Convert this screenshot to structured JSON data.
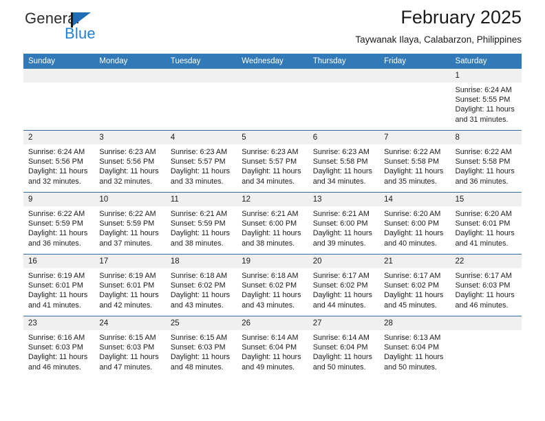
{
  "brand": {
    "name_part1": "General",
    "name_part2": "Blue",
    "flag_icon": "triangle-flag-icon",
    "accent_color": "#1f7fd0"
  },
  "header": {
    "title": "February 2025",
    "subtitle": "Taywanak Ilaya, Calabarzon, Philippines"
  },
  "theme": {
    "header_row_color": "#3279b8",
    "daynum_band_color": "#f0f0f0",
    "row_divider_color": "#2f6ea5"
  },
  "calendar": {
    "weekday_headers": [
      "Sunday",
      "Monday",
      "Tuesday",
      "Wednesday",
      "Thursday",
      "Friday",
      "Saturday"
    ],
    "weeks": [
      [
        {
          "day": "",
          "sunrise": "",
          "sunset": "",
          "daylight1": "",
          "daylight2": ""
        },
        {
          "day": "",
          "sunrise": "",
          "sunset": "",
          "daylight1": "",
          "daylight2": ""
        },
        {
          "day": "",
          "sunrise": "",
          "sunset": "",
          "daylight1": "",
          "daylight2": ""
        },
        {
          "day": "",
          "sunrise": "",
          "sunset": "",
          "daylight1": "",
          "daylight2": ""
        },
        {
          "day": "",
          "sunrise": "",
          "sunset": "",
          "daylight1": "",
          "daylight2": ""
        },
        {
          "day": "",
          "sunrise": "",
          "sunset": "",
          "daylight1": "",
          "daylight2": ""
        },
        {
          "day": "1",
          "sunrise": "Sunrise: 6:24 AM",
          "sunset": "Sunset: 5:55 PM",
          "daylight1": "Daylight: 11 hours",
          "daylight2": "and 31 minutes."
        }
      ],
      [
        {
          "day": "2",
          "sunrise": "Sunrise: 6:24 AM",
          "sunset": "Sunset: 5:56 PM",
          "daylight1": "Daylight: 11 hours",
          "daylight2": "and 32 minutes."
        },
        {
          "day": "3",
          "sunrise": "Sunrise: 6:23 AM",
          "sunset": "Sunset: 5:56 PM",
          "daylight1": "Daylight: 11 hours",
          "daylight2": "and 32 minutes."
        },
        {
          "day": "4",
          "sunrise": "Sunrise: 6:23 AM",
          "sunset": "Sunset: 5:57 PM",
          "daylight1": "Daylight: 11 hours",
          "daylight2": "and 33 minutes."
        },
        {
          "day": "5",
          "sunrise": "Sunrise: 6:23 AM",
          "sunset": "Sunset: 5:57 PM",
          "daylight1": "Daylight: 11 hours",
          "daylight2": "and 34 minutes."
        },
        {
          "day": "6",
          "sunrise": "Sunrise: 6:23 AM",
          "sunset": "Sunset: 5:58 PM",
          "daylight1": "Daylight: 11 hours",
          "daylight2": "and 34 minutes."
        },
        {
          "day": "7",
          "sunrise": "Sunrise: 6:22 AM",
          "sunset": "Sunset: 5:58 PM",
          "daylight1": "Daylight: 11 hours",
          "daylight2": "and 35 minutes."
        },
        {
          "day": "8",
          "sunrise": "Sunrise: 6:22 AM",
          "sunset": "Sunset: 5:58 PM",
          "daylight1": "Daylight: 11 hours",
          "daylight2": "and 36 minutes."
        }
      ],
      [
        {
          "day": "9",
          "sunrise": "Sunrise: 6:22 AM",
          "sunset": "Sunset: 5:59 PM",
          "daylight1": "Daylight: 11 hours",
          "daylight2": "and 36 minutes."
        },
        {
          "day": "10",
          "sunrise": "Sunrise: 6:22 AM",
          "sunset": "Sunset: 5:59 PM",
          "daylight1": "Daylight: 11 hours",
          "daylight2": "and 37 minutes."
        },
        {
          "day": "11",
          "sunrise": "Sunrise: 6:21 AM",
          "sunset": "Sunset: 5:59 PM",
          "daylight1": "Daylight: 11 hours",
          "daylight2": "and 38 minutes."
        },
        {
          "day": "12",
          "sunrise": "Sunrise: 6:21 AM",
          "sunset": "Sunset: 6:00 PM",
          "daylight1": "Daylight: 11 hours",
          "daylight2": "and 38 minutes."
        },
        {
          "day": "13",
          "sunrise": "Sunrise: 6:21 AM",
          "sunset": "Sunset: 6:00 PM",
          "daylight1": "Daylight: 11 hours",
          "daylight2": "and 39 minutes."
        },
        {
          "day": "14",
          "sunrise": "Sunrise: 6:20 AM",
          "sunset": "Sunset: 6:00 PM",
          "daylight1": "Daylight: 11 hours",
          "daylight2": "and 40 minutes."
        },
        {
          "day": "15",
          "sunrise": "Sunrise: 6:20 AM",
          "sunset": "Sunset: 6:01 PM",
          "daylight1": "Daylight: 11 hours",
          "daylight2": "and 41 minutes."
        }
      ],
      [
        {
          "day": "16",
          "sunrise": "Sunrise: 6:19 AM",
          "sunset": "Sunset: 6:01 PM",
          "daylight1": "Daylight: 11 hours",
          "daylight2": "and 41 minutes."
        },
        {
          "day": "17",
          "sunrise": "Sunrise: 6:19 AM",
          "sunset": "Sunset: 6:01 PM",
          "daylight1": "Daylight: 11 hours",
          "daylight2": "and 42 minutes."
        },
        {
          "day": "18",
          "sunrise": "Sunrise: 6:18 AM",
          "sunset": "Sunset: 6:02 PM",
          "daylight1": "Daylight: 11 hours",
          "daylight2": "and 43 minutes."
        },
        {
          "day": "19",
          "sunrise": "Sunrise: 6:18 AM",
          "sunset": "Sunset: 6:02 PM",
          "daylight1": "Daylight: 11 hours",
          "daylight2": "and 43 minutes."
        },
        {
          "day": "20",
          "sunrise": "Sunrise: 6:17 AM",
          "sunset": "Sunset: 6:02 PM",
          "daylight1": "Daylight: 11 hours",
          "daylight2": "and 44 minutes."
        },
        {
          "day": "21",
          "sunrise": "Sunrise: 6:17 AM",
          "sunset": "Sunset: 6:02 PM",
          "daylight1": "Daylight: 11 hours",
          "daylight2": "and 45 minutes."
        },
        {
          "day": "22",
          "sunrise": "Sunrise: 6:17 AM",
          "sunset": "Sunset: 6:03 PM",
          "daylight1": "Daylight: 11 hours",
          "daylight2": "and 46 minutes."
        }
      ],
      [
        {
          "day": "23",
          "sunrise": "Sunrise: 6:16 AM",
          "sunset": "Sunset: 6:03 PM",
          "daylight1": "Daylight: 11 hours",
          "daylight2": "and 46 minutes."
        },
        {
          "day": "24",
          "sunrise": "Sunrise: 6:15 AM",
          "sunset": "Sunset: 6:03 PM",
          "daylight1": "Daylight: 11 hours",
          "daylight2": "and 47 minutes."
        },
        {
          "day": "25",
          "sunrise": "Sunrise: 6:15 AM",
          "sunset": "Sunset: 6:03 PM",
          "daylight1": "Daylight: 11 hours",
          "daylight2": "and 48 minutes."
        },
        {
          "day": "26",
          "sunrise": "Sunrise: 6:14 AM",
          "sunset": "Sunset: 6:04 PM",
          "daylight1": "Daylight: 11 hours",
          "daylight2": "and 49 minutes."
        },
        {
          "day": "27",
          "sunrise": "Sunrise: 6:14 AM",
          "sunset": "Sunset: 6:04 PM",
          "daylight1": "Daylight: 11 hours",
          "daylight2": "and 50 minutes."
        },
        {
          "day": "28",
          "sunrise": "Sunrise: 6:13 AM",
          "sunset": "Sunset: 6:04 PM",
          "daylight1": "Daylight: 11 hours",
          "daylight2": "and 50 minutes."
        },
        {
          "day": "",
          "sunrise": "",
          "sunset": "",
          "daylight1": "",
          "daylight2": ""
        }
      ]
    ]
  }
}
